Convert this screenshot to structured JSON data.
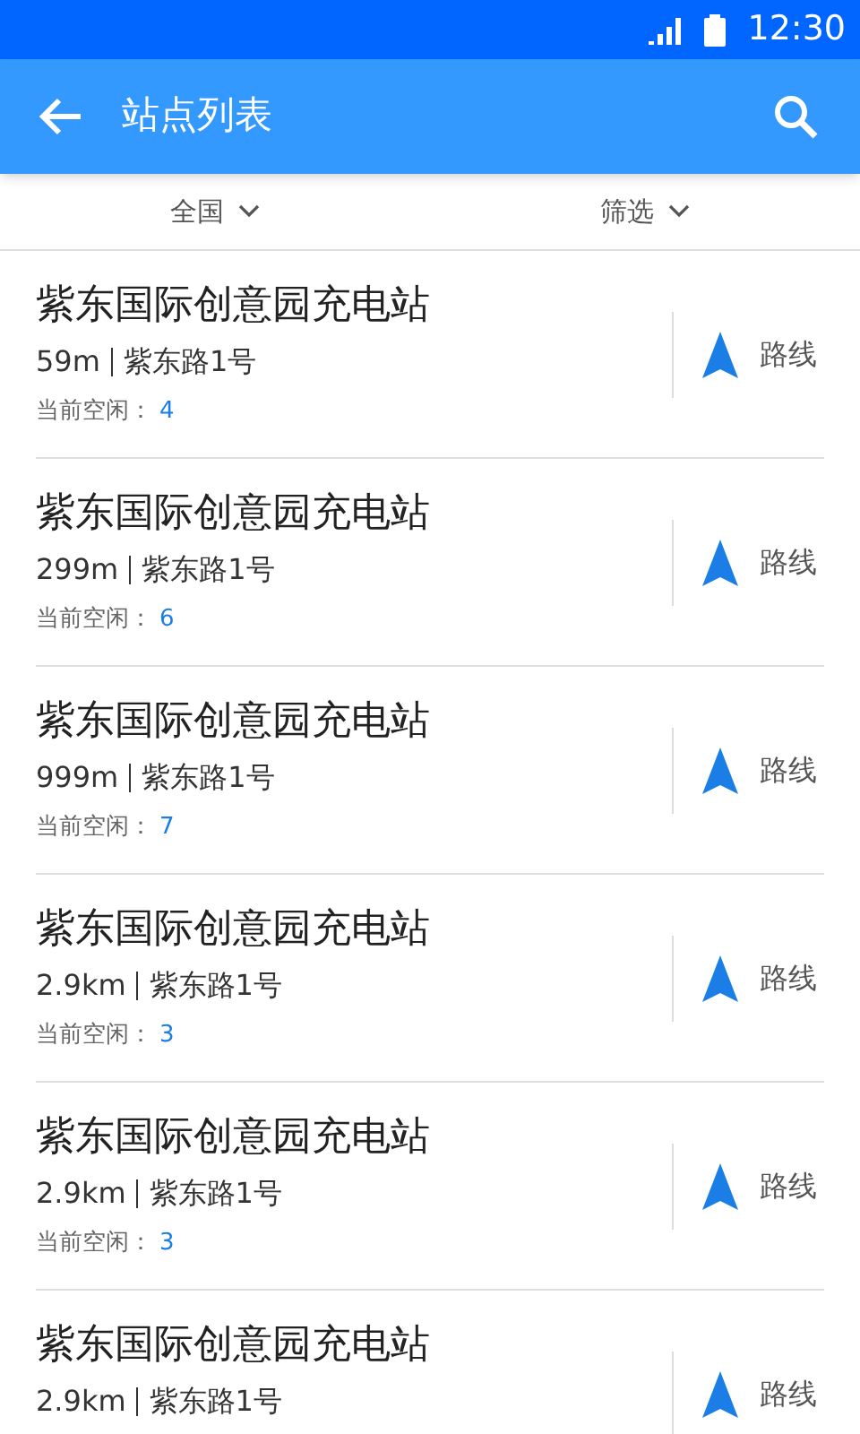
{
  "status_bar": {
    "time": "12:30"
  },
  "app_bar": {
    "title": "站点列表"
  },
  "filters": [
    {
      "label": "全国"
    },
    {
      "label": "筛选"
    }
  ],
  "stations": [
    {
      "name": "紫东国际创意园充电站",
      "distance": "59m",
      "address": "紫东路1号",
      "free_label": "当前空闲：",
      "free_count": "4",
      "route": "路线"
    },
    {
      "name": "紫东国际创意园充电站",
      "distance": "299m",
      "address": "紫东路1号",
      "free_label": "当前空闲：",
      "free_count": "6",
      "route": "路线"
    },
    {
      "name": "紫东国际创意园充电站",
      "distance": "999m",
      "address": "紫东路1号",
      "free_label": "当前空闲：",
      "free_count": "7",
      "route": "路线"
    },
    {
      "name": "紫东国际创意园充电站",
      "distance": "2.9km",
      "address": "紫东路1号",
      "free_label": "当前空闲：",
      "free_count": "3",
      "route": "路线"
    },
    {
      "name": "紫东国际创意园充电站",
      "distance": "2.9km",
      "address": "紫东路1号",
      "free_label": "当前空闲：",
      "free_count": "3",
      "route": "路线"
    },
    {
      "name": "紫东国际创意园充电站",
      "distance": "2.9km",
      "address": "紫东路1号",
      "route": "路线"
    }
  ]
}
